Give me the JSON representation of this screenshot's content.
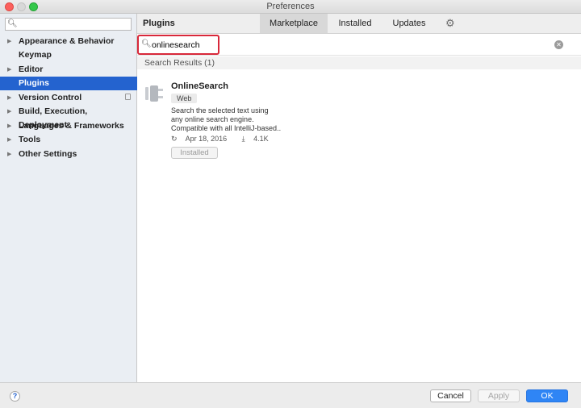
{
  "window": {
    "title": "Preferences"
  },
  "sidebar": {
    "search_placeholder": "",
    "items": [
      {
        "label": "Appearance & Behavior",
        "expandable": true
      },
      {
        "label": "Keymap",
        "expandable": false
      },
      {
        "label": "Editor",
        "expandable": true
      },
      {
        "label": "Plugins",
        "expandable": false,
        "selected": true
      },
      {
        "label": "Version Control",
        "expandable": true
      },
      {
        "label": "Build, Execution, Deployment",
        "expandable": true
      },
      {
        "label": "Languages & Frameworks",
        "expandable": true
      },
      {
        "label": "Tools",
        "expandable": true
      },
      {
        "label": "Other Settings",
        "expandable": true
      }
    ]
  },
  "header": {
    "title": "Plugins",
    "tabs": [
      {
        "label": "Marketplace",
        "active": true
      },
      {
        "label": "Installed",
        "active": false
      },
      {
        "label": "Updates",
        "active": false
      }
    ],
    "settings_icon": "gear-icon"
  },
  "search": {
    "value": "onlinesearch",
    "highlight_color": "#d8283a"
  },
  "results": {
    "header": "Search Results (1)",
    "plugins": [
      {
        "name": "OnlineSearch",
        "tag": "Web",
        "description_lines": [
          "Search the selected text using",
          "any online search engine.",
          "Compatible with all IntelliJ-based.."
        ],
        "date": "Apr 18, 2016",
        "downloads": "4.1K",
        "button_label": "Installed"
      }
    ]
  },
  "footer": {
    "help_label": "?",
    "cancel_label": "Cancel",
    "apply_label": "Apply",
    "ok_label": "OK"
  },
  "colors": {
    "selection": "#2463cf",
    "ok_button": "#2f85f5",
    "sidebar_bg": "#eaeef3"
  }
}
